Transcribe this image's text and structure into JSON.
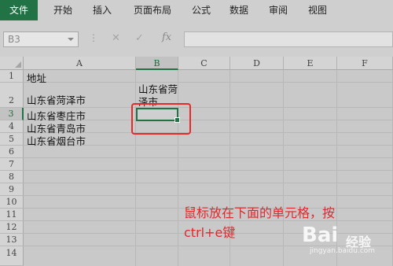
{
  "ribbon": {
    "tabs": [
      "文件",
      "开始",
      "插入",
      "页面布局",
      "公式",
      "数据",
      "审阅",
      "视图"
    ]
  },
  "formula_bar": {
    "name_box": "B3",
    "dots": "⋮",
    "cancel": "✕",
    "confirm": "✓",
    "fx": "fx",
    "value": ""
  },
  "sheet": {
    "columns": [
      "A",
      "B",
      "C",
      "D",
      "E",
      "F"
    ],
    "rows": [
      "1",
      "2",
      "3",
      "4",
      "5",
      "6",
      "7",
      "8",
      "9",
      "10",
      "11",
      "12",
      "13",
      "14"
    ],
    "cells": {
      "A1": "地址",
      "A2": "山东省菏泽市",
      "B2": "山东省菏泽市",
      "A3": "山东省枣庄市",
      "A4": "山东省青岛市",
      "A5": "山东省烟台市"
    },
    "active_cell": "B3"
  },
  "annotation": {
    "line1": "鼠标放在下面的单元格，按",
    "line2": "ctrl+e键"
  },
  "watermark": {
    "brand": "Bai",
    "brand2": "经验",
    "site": "jingyan.baidu.com"
  },
  "colors": {
    "excel_green": "#217346",
    "annotation_red": "#e0282d"
  }
}
